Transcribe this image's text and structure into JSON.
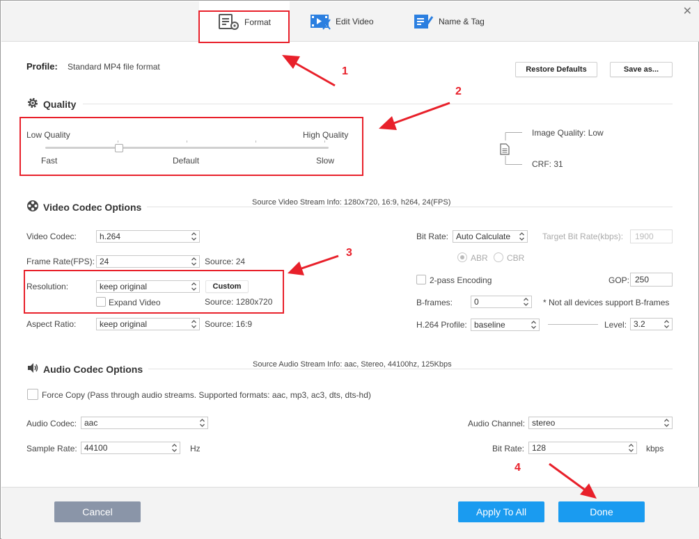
{
  "tabs": [
    {
      "label": "Format",
      "icon": "format-settings-icon"
    },
    {
      "label": "Edit Video",
      "icon": "edit-video-icon"
    },
    {
      "label": "Name & Tag",
      "icon": "name-tag-icon"
    }
  ],
  "close_icon": "close-icon",
  "profile": {
    "label": "Profile:",
    "value": "Standard MP4 file format",
    "restore_defaults": "Restore Defaults",
    "save_as": "Save as..."
  },
  "quality": {
    "title": "Quality",
    "low_label": "Low Quality",
    "high_label": "High Quality",
    "fast_label": "Fast",
    "default_label": "Default",
    "slow_label": "Slow",
    "slider_level": 0.26,
    "image_quality": "Image Quality: Low",
    "crf": "CRF: 31"
  },
  "video": {
    "title": "Video Codec Options",
    "source_info": "Source Video Stream Info: 1280x720, 16:9, h264, 24(FPS)",
    "codec_label": "Video Codec:",
    "codec_value": "h.264",
    "framerate_label": "Frame Rate(FPS):",
    "framerate_value": "24",
    "framerate_source": "Source: 24",
    "resolution_label": "Resolution:",
    "resolution_value": "keep original",
    "custom_button": "Custom",
    "expand_label": "Expand Video",
    "resolution_source": "Source: 1280x720",
    "aspect_label": "Aspect Ratio:",
    "aspect_value": "keep original",
    "aspect_source": "Source: 16:9",
    "bitrate_label": "Bit Rate:",
    "bitrate_value": "Auto Calculate",
    "target_bitrate_label": "Target Bit Rate(kbps):",
    "target_bitrate_value": "1900",
    "abr_label": "ABR",
    "cbr_label": "CBR",
    "twopass_label": "2-pass Encoding",
    "gop_label": "GOP:",
    "gop_value": "250",
    "bframes_label": "B-frames:",
    "bframes_value": "0",
    "bframes_note": "* Not all devices support B-frames",
    "profile_label": "H.264 Profile:",
    "profile_value": "baseline",
    "level_label": "Level:",
    "level_value": "3.2"
  },
  "audio": {
    "title": "Audio Codec Options",
    "source_info": "Source Audio Stream Info: aac, Stereo, 44100hz, 125Kbps",
    "force_copy": "Force Copy (Pass through audio streams. Supported formats: aac, mp3, ac3, dts, dts-hd)",
    "codec_label": "Audio Codec:",
    "codec_value": "aac",
    "channel_label": "Audio Channel:",
    "channel_value": "stereo",
    "samplerate_label": "Sample Rate:",
    "samplerate_value": "44100",
    "samplerate_unit": "Hz",
    "bitrate_label": "Bit Rate:",
    "bitrate_value": "128",
    "bitrate_unit": "kbps"
  },
  "annotations": [
    "1",
    "2",
    "3",
    "4"
  ],
  "buttons": {
    "cancel": "Cancel",
    "apply_all": "Apply To All",
    "done": "Done"
  },
  "colors": {
    "accent_blue": "#1a9bf0",
    "cancel_gray": "#8a95a8",
    "annotation_red": "#e8202a"
  }
}
